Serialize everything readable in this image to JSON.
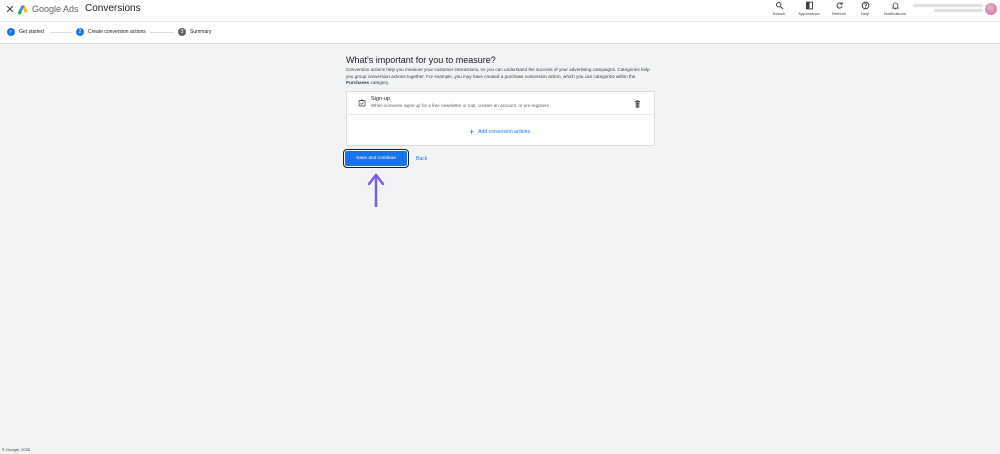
{
  "header": {
    "close_glyph": "✕",
    "brand": "Google Ads",
    "page_title": "Conversions",
    "tools": [
      {
        "label": "Search",
        "icon": "search-icon"
      },
      {
        "label": "Appearance",
        "icon": "appearance-icon"
      },
      {
        "label": "Refresh",
        "icon": "refresh-icon"
      },
      {
        "label": "Help",
        "icon": "help-icon"
      },
      {
        "label": "Notifications",
        "icon": "bell-icon"
      }
    ]
  },
  "stepper": {
    "steps": [
      {
        "label": "Get started",
        "state": "done",
        "marker": "✓"
      },
      {
        "label": "Create conversion actions",
        "state": "current",
        "marker": "2"
      },
      {
        "label": "Summary",
        "state": "todo",
        "marker": "3"
      }
    ]
  },
  "main": {
    "title": "What's important for you to measure?",
    "intro_part1": "Conversion actions help you measure your customer interactions, so you can understand the success of your advertising campaigns. Categories help you group conversion actions together. For example, you may have created a purchase conversion action, which you can categorize within the ",
    "intro_bold": "Purchases",
    "intro_part2": " category.",
    "items": [
      {
        "title": "Sign-up",
        "description": "When someone signs up for a free newsletter or trial, creates an account, or pre-registers"
      }
    ],
    "add_label": "Add conversion actions",
    "save_label": "Save and continue",
    "back_label": "Back"
  },
  "footer": {
    "copyright": "© Google, 2025"
  },
  "colors": {
    "primary": "#1a73e8",
    "background": "#f1f3f4",
    "arrow": "#7b5ce6"
  }
}
